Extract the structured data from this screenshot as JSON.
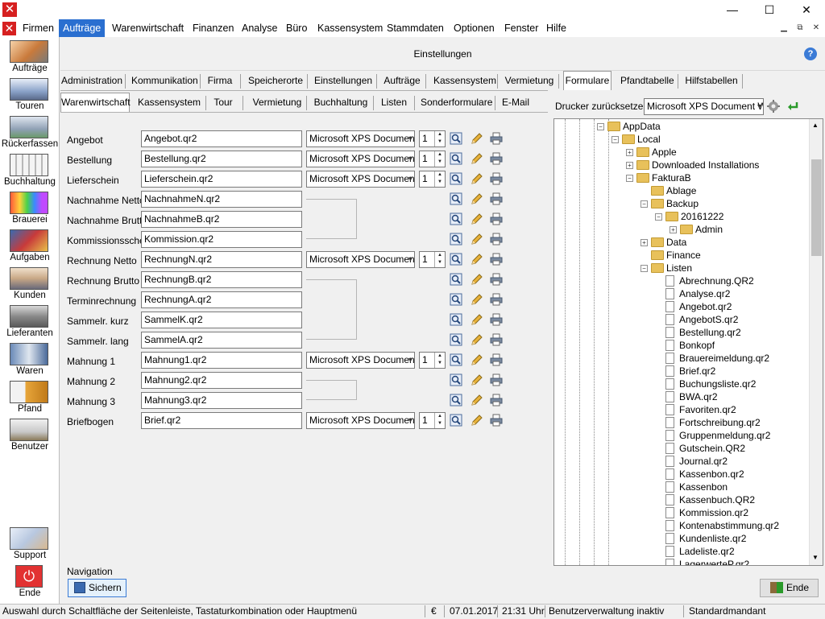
{
  "window": {
    "minimize": "—",
    "maximize": "☐",
    "close": "✕"
  },
  "menu": [
    "Firmen",
    "Aufträge",
    "Warenwirtschaft",
    "Finanzen",
    "Analyse",
    "Büro",
    "Kassensystem",
    "Stammdaten",
    "Optionen",
    "Fenster",
    "Hilfe"
  ],
  "sidebar": [
    "Aufträge",
    "Touren",
    "Rückerfassen",
    "Buchhaltung",
    "Brauerei",
    "Aufgaben",
    "Kunden",
    "Lieferanten",
    "Waren",
    "Pfand",
    "Benutzer",
    "Support",
    "Ende"
  ],
  "header": {
    "title": "Einstellungen"
  },
  "tabs_row1": [
    "Administration",
    "Kommunikation",
    "Firma",
    "Speicherorte",
    "Einstellungen",
    "Aufträge",
    "Kassensystem",
    "Vermietung",
    "Formulare",
    "Pfandtabelle",
    "Hilfstabellen"
  ],
  "tabs_row2": [
    "Warenwirtschaft",
    "Kassensystem",
    "Tour",
    "Vermietung",
    "Buchhaltung",
    "Listen",
    "Sonderformulare",
    "E-Mail"
  ],
  "printer_reset": {
    "label": "Drucker zurücksetzen:",
    "value": "Microsoft XPS Document W"
  },
  "form": [
    {
      "label": "Angebot",
      "file": "Angebot.qr2",
      "printer": "Microsoft XPS Documen",
      "copies": "1"
    },
    {
      "label": "Bestellung",
      "file": "Bestellung.qr2",
      "printer": "Microsoft XPS Documen",
      "copies": "1"
    },
    {
      "label": "Lieferschein",
      "file": "Lieferschein.qr2",
      "printer": "Microsoft XPS Documen",
      "copies": "1"
    },
    {
      "label": "Nachnahme Netto",
      "file": "NachnahmeN.qr2"
    },
    {
      "label": "Nachnahme Brutto",
      "file": "NachnahmeB.qr2"
    },
    {
      "label": "Kommissionsschein",
      "file": "Kommission.qr2"
    },
    {
      "label": "Rechnung Netto",
      "file": "RechnungN.qr2",
      "printer": "Microsoft XPS Documen",
      "copies": "1"
    },
    {
      "label": "Rechnung Brutto",
      "file": "RechnungB.qr2"
    },
    {
      "label": "Terminrechnung",
      "file": "RechnungA.qr2"
    },
    {
      "label": "Sammelr. kurz",
      "file": "SammelK.qr2"
    },
    {
      "label": "Sammelr. lang",
      "file": "SammelA.qr2"
    },
    {
      "label": "Mahnung 1",
      "file": "Mahnung1.qr2",
      "printer": "Microsoft XPS Documen",
      "copies": "1"
    },
    {
      "label": "Mahnung 2",
      "file": "Mahnung2.qr2"
    },
    {
      "label": "Mahnung 3",
      "file": "Mahnung3.qr2"
    },
    {
      "label": "Briefbogen",
      "file": "Brief.qr2",
      "printer": "Microsoft XPS Documen",
      "copies": "1"
    }
  ],
  "tree": [
    {
      "label": "AppData",
      "type": "folder",
      "exp": "-"
    },
    {
      "label": "Local",
      "type": "folder",
      "exp": "-"
    },
    {
      "label": "Apple",
      "type": "folder",
      "exp": "+"
    },
    {
      "label": "Downloaded Installations",
      "type": "folder",
      "exp": "+"
    },
    {
      "label": "FakturaB",
      "type": "folder",
      "exp": "-"
    },
    {
      "label": "Ablage",
      "type": "folder",
      "exp": ""
    },
    {
      "label": "Backup",
      "type": "folder",
      "exp": "-"
    },
    {
      "label": "20161222",
      "type": "folder",
      "exp": "-"
    },
    {
      "label": "Admin",
      "type": "folder",
      "exp": "+"
    },
    {
      "label": "Data",
      "type": "folder",
      "exp": "+"
    },
    {
      "label": "Finance",
      "type": "folder",
      "exp": ""
    },
    {
      "label": "Listen",
      "type": "folder",
      "exp": "-"
    },
    {
      "label": "Abrechnung.QR2",
      "type": "file"
    },
    {
      "label": "Analyse.qr2",
      "type": "file"
    },
    {
      "label": "Angebot.qr2",
      "type": "file"
    },
    {
      "label": "AngebotS.qr2",
      "type": "file"
    },
    {
      "label": "Bestellung.qr2",
      "type": "file"
    },
    {
      "label": "Bonkopf",
      "type": "file"
    },
    {
      "label": "Brauereimeldung.qr2",
      "type": "file"
    },
    {
      "label": "Brief.qr2",
      "type": "file"
    },
    {
      "label": "Buchungsliste.qr2",
      "type": "file"
    },
    {
      "label": "BWA.qr2",
      "type": "file"
    },
    {
      "label": "Favoriten.qr2",
      "type": "file"
    },
    {
      "label": "Fortschreibung.qr2",
      "type": "file"
    },
    {
      "label": "Gruppenmeldung.qr2",
      "type": "file"
    },
    {
      "label": "Gutschein.QR2",
      "type": "file"
    },
    {
      "label": "Journal.qr2",
      "type": "file"
    },
    {
      "label": "Kassenbon.qr2",
      "type": "file"
    },
    {
      "label": "Kassenbon",
      "type": "file"
    },
    {
      "label": "Kassenbuch.QR2",
      "type": "file"
    },
    {
      "label": "Kommission.qr2",
      "type": "file"
    },
    {
      "label": "Kontenabstimmung.qr2",
      "type": "file"
    },
    {
      "label": "Kundenliste.qr2",
      "type": "file"
    },
    {
      "label": "Ladeliste.qr2",
      "type": "file"
    },
    {
      "label": "LagerwerteP.qr2",
      "type": "file"
    }
  ],
  "navigation": {
    "label": "Navigation",
    "save": "Sichern",
    "end": "Ende"
  },
  "status": {
    "hint": "Auswahl durch Schaltfläche der Seitenleiste, Tastaturkombination oder Hauptmenü",
    "currency": "€",
    "date": "07.01.2017",
    "time": "21:31 Uhr",
    "user_admin": "Benutzerverwaltung inaktiv",
    "client": "Standardmandant"
  },
  "colors": {
    "accent": "#2a6fd0",
    "logo": "#d62020",
    "folder": "#e8c15b"
  }
}
